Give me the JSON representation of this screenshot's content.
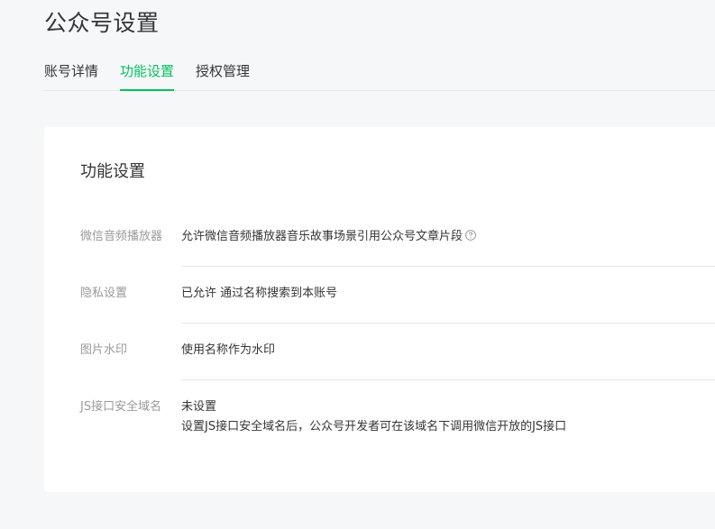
{
  "header": {
    "title": "公众号设置"
  },
  "tabs": [
    {
      "label": "账号详情",
      "active": false
    },
    {
      "label": "功能设置",
      "active": true
    },
    {
      "label": "授权管理",
      "active": false
    }
  ],
  "settings": {
    "title": "功能设置",
    "rows": [
      {
        "label": "微信音频播放器",
        "value": "允许微信音频播放器音乐故事场景引用公众号文章片段",
        "icon": "help-icon"
      },
      {
        "label": "隐私设置",
        "value": "已允许 通过名称搜索到本账号"
      },
      {
        "label": "图片水印",
        "value": "使用名称作为水印"
      },
      {
        "label": "JS接口安全域名",
        "value": "未设置",
        "note": "设置JS接口安全域名后，公众号开发者可在该域名下调用微信开放的JS接口"
      }
    ]
  },
  "colors": {
    "accent": "#07c160",
    "background": "#f6f7f9",
    "label": "#9a9a9a"
  }
}
